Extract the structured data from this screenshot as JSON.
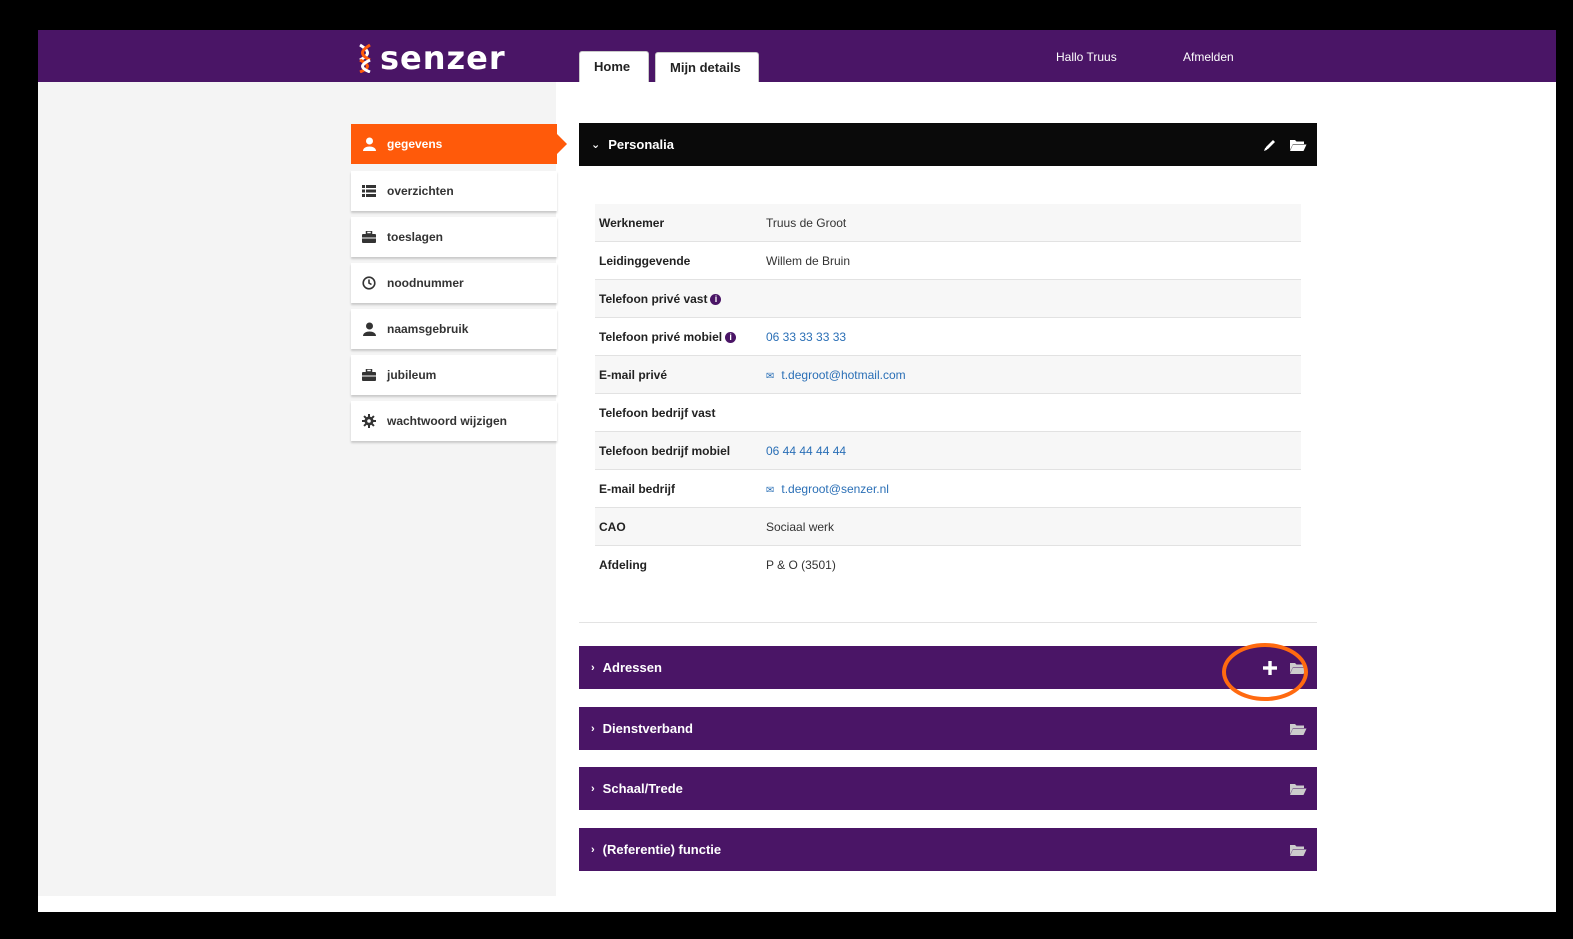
{
  "header": {
    "logo_text": "senzer",
    "tabs": [
      {
        "label": "Home"
      },
      {
        "label": "Mijn details"
      }
    ],
    "greeting": "Hallo Truus",
    "logout": "Afmelden"
  },
  "sidebar": {
    "items": [
      {
        "label": "gegevens",
        "icon": "user-icon",
        "active": true
      },
      {
        "label": "overzichten",
        "icon": "list-icon"
      },
      {
        "label": "toeslagen",
        "icon": "briefcase-icon"
      },
      {
        "label": "noodnummer",
        "icon": "clock-icon"
      },
      {
        "label": "naamsgebruik",
        "icon": "user-icon"
      },
      {
        "label": "jubileum",
        "icon": "briefcase-icon"
      },
      {
        "label": "wachtwoord wijzigen",
        "icon": "gear-icon"
      }
    ]
  },
  "personalia": {
    "title": "Personalia",
    "rows": [
      {
        "label": "Werknemer",
        "value": "Truus de Groot"
      },
      {
        "label": "Leidinggevende",
        "value": "Willem de Bruin"
      },
      {
        "label": "Telefoon privé vast",
        "value": ""
      },
      {
        "label": "Telefoon privé mobiel",
        "value": "06 33 33 33 33"
      },
      {
        "label": "E-mail privé",
        "value": "t.degroot@hotmail.com"
      },
      {
        "label": "Telefoon bedrijf vast",
        "value": ""
      },
      {
        "label": "Telefoon bedrijf mobiel",
        "value": "06 44 44 44 44"
      },
      {
        "label": "E-mail bedrijf",
        "value": "t.degroot@senzer.nl"
      },
      {
        "label": "CAO",
        "value": "Sociaal werk"
      },
      {
        "label": "Afdeling",
        "value": "P & O (3501)"
      }
    ]
  },
  "sections": [
    {
      "title": "Adressen"
    },
    {
      "title": "Dienstverband"
    },
    {
      "title": "Schaal/Trede"
    },
    {
      "title": "(Referentie) functie"
    }
  ],
  "colors": {
    "brand_purple": "#4a1566",
    "accent_orange": "#ff5a0a",
    "link_blue": "#2a6fb6"
  }
}
